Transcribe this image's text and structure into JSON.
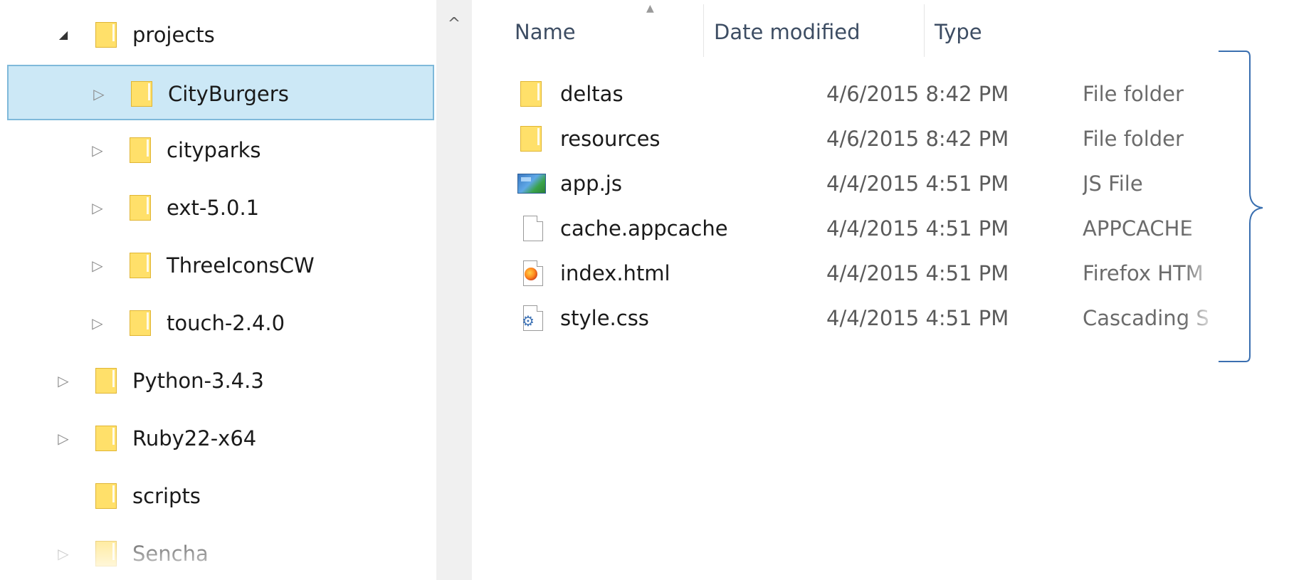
{
  "navigation": {
    "items": [
      {
        "label": "projects",
        "toggle": "◢",
        "level": 1,
        "selected": false
      },
      {
        "label": "CityBurgers",
        "toggle": "▷",
        "level": 2,
        "selected": true
      },
      {
        "label": "cityparks",
        "toggle": "▷",
        "level": 2,
        "selected": false
      },
      {
        "label": "ext-5.0.1",
        "toggle": "▷",
        "level": 2,
        "selected": false
      },
      {
        "label": "ThreeIconsCW",
        "toggle": "▷",
        "level": 2,
        "selected": false
      },
      {
        "label": "touch-2.4.0",
        "toggle": "▷",
        "level": 2,
        "selected": false
      },
      {
        "label": "Python-3.4.3",
        "toggle": "▷",
        "level": 1,
        "selected": false
      },
      {
        "label": "Ruby22-x64",
        "toggle": "▷",
        "level": 1,
        "selected": false
      },
      {
        "label": "scripts",
        "toggle": "",
        "level": 1,
        "selected": false
      },
      {
        "label": "Sencha",
        "toggle": "▷",
        "level": 1,
        "selected": false
      }
    ],
    "scroll_up": "^"
  },
  "file_list": {
    "columns": {
      "name": "Name",
      "date": "Date modified",
      "type": "Type"
    },
    "sort_indicator": "▲",
    "rows": [
      {
        "name": "deltas",
        "date": "4/6/2015 8:42 PM",
        "type": "File folder",
        "icon": "folder-icon"
      },
      {
        "name": "resources",
        "date": "4/6/2015 8:42 PM",
        "type": "File folder",
        "icon": "folder-icon"
      },
      {
        "name": "app.js",
        "date": "4/4/2015 4:51 PM",
        "type": "JS File",
        "icon": "js-file-icon"
      },
      {
        "name": "cache.appcache",
        "date": "4/4/2015 4:51 PM",
        "type": "APPCACHE",
        "icon": "blank-file-icon"
      },
      {
        "name": "index.html",
        "date": "4/4/2015 4:51 PM",
        "type": "Firefox HTM",
        "icon": "firefox-html-icon"
      },
      {
        "name": "style.css",
        "date": "4/4/2015 4:51 PM",
        "type": "Cascading S",
        "icon": "css-file-icon"
      }
    ]
  },
  "colors": {
    "selection_fill": "#cce8f6",
    "selection_border": "#7fb9da",
    "folder_yellow": "#ffe06a",
    "header_text": "#3d4d63",
    "bracket": "#3a6fb0"
  }
}
